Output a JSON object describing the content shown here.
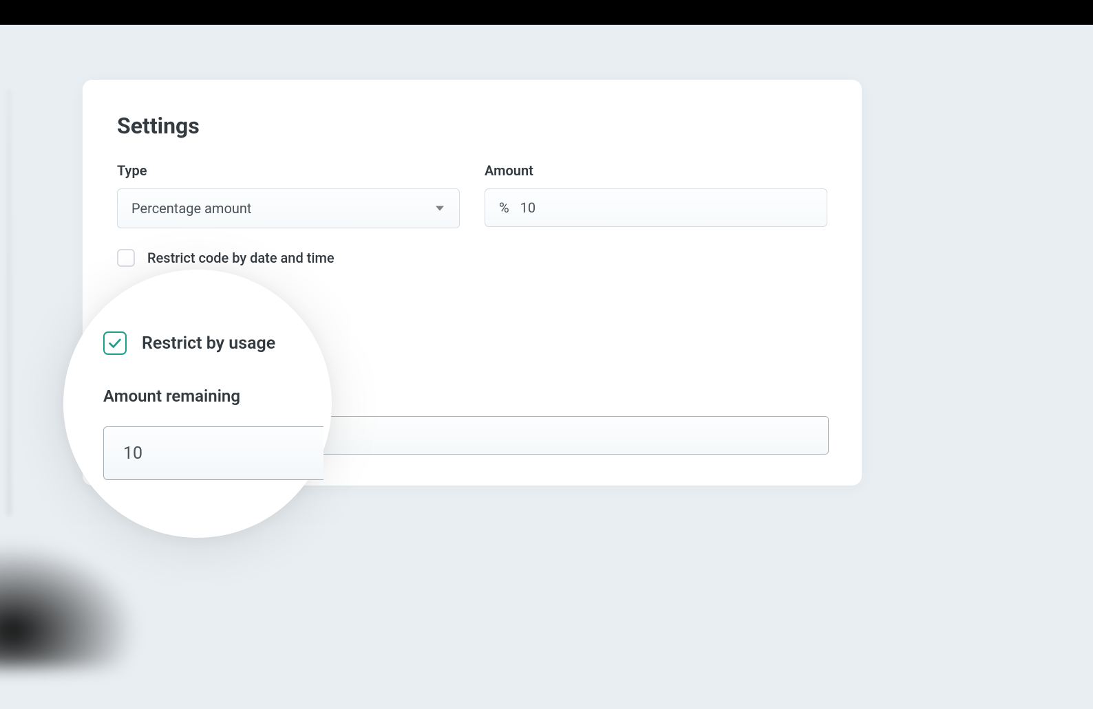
{
  "title": "Settings",
  "type": {
    "label": "Type",
    "selected": "Percentage amount"
  },
  "amount": {
    "label": "Amount",
    "prefix": "%",
    "value": "10"
  },
  "restrict_date": {
    "label": "Restrict code by date and time",
    "checked": false
  },
  "restrict_usage": {
    "label": "Restrict by usage",
    "checked": true
  },
  "amount_remaining": {
    "label": "Amount remaining",
    "value": "10"
  },
  "colors": {
    "accent": "#1d9e8c",
    "text": "#333a40",
    "border": "#d7dde2"
  }
}
